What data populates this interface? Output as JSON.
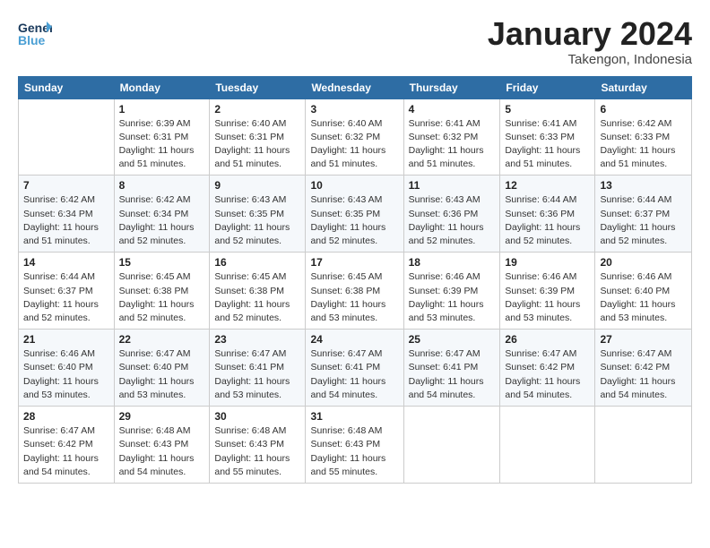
{
  "header": {
    "logo_general": "General",
    "logo_blue": "Blue",
    "month_title": "January 2024",
    "location": "Takengon, Indonesia"
  },
  "days_of_week": [
    "Sunday",
    "Monday",
    "Tuesday",
    "Wednesday",
    "Thursday",
    "Friday",
    "Saturday"
  ],
  "weeks": [
    [
      {
        "day": "",
        "sunrise": "",
        "sunset": "",
        "daylight": ""
      },
      {
        "day": "1",
        "sunrise": "Sunrise: 6:39 AM",
        "sunset": "Sunset: 6:31 PM",
        "daylight": "Daylight: 11 hours and 51 minutes."
      },
      {
        "day": "2",
        "sunrise": "Sunrise: 6:40 AM",
        "sunset": "Sunset: 6:31 PM",
        "daylight": "Daylight: 11 hours and 51 minutes."
      },
      {
        "day": "3",
        "sunrise": "Sunrise: 6:40 AM",
        "sunset": "Sunset: 6:32 PM",
        "daylight": "Daylight: 11 hours and 51 minutes."
      },
      {
        "day": "4",
        "sunrise": "Sunrise: 6:41 AM",
        "sunset": "Sunset: 6:32 PM",
        "daylight": "Daylight: 11 hours and 51 minutes."
      },
      {
        "day": "5",
        "sunrise": "Sunrise: 6:41 AM",
        "sunset": "Sunset: 6:33 PM",
        "daylight": "Daylight: 11 hours and 51 minutes."
      },
      {
        "day": "6",
        "sunrise": "Sunrise: 6:42 AM",
        "sunset": "Sunset: 6:33 PM",
        "daylight": "Daylight: 11 hours and 51 minutes."
      }
    ],
    [
      {
        "day": "7",
        "sunrise": "Sunrise: 6:42 AM",
        "sunset": "Sunset: 6:34 PM",
        "daylight": "Daylight: 11 hours and 51 minutes."
      },
      {
        "day": "8",
        "sunrise": "Sunrise: 6:42 AM",
        "sunset": "Sunset: 6:34 PM",
        "daylight": "Daylight: 11 hours and 52 minutes."
      },
      {
        "day": "9",
        "sunrise": "Sunrise: 6:43 AM",
        "sunset": "Sunset: 6:35 PM",
        "daylight": "Daylight: 11 hours and 52 minutes."
      },
      {
        "day": "10",
        "sunrise": "Sunrise: 6:43 AM",
        "sunset": "Sunset: 6:35 PM",
        "daylight": "Daylight: 11 hours and 52 minutes."
      },
      {
        "day": "11",
        "sunrise": "Sunrise: 6:43 AM",
        "sunset": "Sunset: 6:36 PM",
        "daylight": "Daylight: 11 hours and 52 minutes."
      },
      {
        "day": "12",
        "sunrise": "Sunrise: 6:44 AM",
        "sunset": "Sunset: 6:36 PM",
        "daylight": "Daylight: 11 hours and 52 minutes."
      },
      {
        "day": "13",
        "sunrise": "Sunrise: 6:44 AM",
        "sunset": "Sunset: 6:37 PM",
        "daylight": "Daylight: 11 hours and 52 minutes."
      }
    ],
    [
      {
        "day": "14",
        "sunrise": "Sunrise: 6:44 AM",
        "sunset": "Sunset: 6:37 PM",
        "daylight": "Daylight: 11 hours and 52 minutes."
      },
      {
        "day": "15",
        "sunrise": "Sunrise: 6:45 AM",
        "sunset": "Sunset: 6:38 PM",
        "daylight": "Daylight: 11 hours and 52 minutes."
      },
      {
        "day": "16",
        "sunrise": "Sunrise: 6:45 AM",
        "sunset": "Sunset: 6:38 PM",
        "daylight": "Daylight: 11 hours and 52 minutes."
      },
      {
        "day": "17",
        "sunrise": "Sunrise: 6:45 AM",
        "sunset": "Sunset: 6:38 PM",
        "daylight": "Daylight: 11 hours and 53 minutes."
      },
      {
        "day": "18",
        "sunrise": "Sunrise: 6:46 AM",
        "sunset": "Sunset: 6:39 PM",
        "daylight": "Daylight: 11 hours and 53 minutes."
      },
      {
        "day": "19",
        "sunrise": "Sunrise: 6:46 AM",
        "sunset": "Sunset: 6:39 PM",
        "daylight": "Daylight: 11 hours and 53 minutes."
      },
      {
        "day": "20",
        "sunrise": "Sunrise: 6:46 AM",
        "sunset": "Sunset: 6:40 PM",
        "daylight": "Daylight: 11 hours and 53 minutes."
      }
    ],
    [
      {
        "day": "21",
        "sunrise": "Sunrise: 6:46 AM",
        "sunset": "Sunset: 6:40 PM",
        "daylight": "Daylight: 11 hours and 53 minutes."
      },
      {
        "day": "22",
        "sunrise": "Sunrise: 6:47 AM",
        "sunset": "Sunset: 6:40 PM",
        "daylight": "Daylight: 11 hours and 53 minutes."
      },
      {
        "day": "23",
        "sunrise": "Sunrise: 6:47 AM",
        "sunset": "Sunset: 6:41 PM",
        "daylight": "Daylight: 11 hours and 53 minutes."
      },
      {
        "day": "24",
        "sunrise": "Sunrise: 6:47 AM",
        "sunset": "Sunset: 6:41 PM",
        "daylight": "Daylight: 11 hours and 54 minutes."
      },
      {
        "day": "25",
        "sunrise": "Sunrise: 6:47 AM",
        "sunset": "Sunset: 6:41 PM",
        "daylight": "Daylight: 11 hours and 54 minutes."
      },
      {
        "day": "26",
        "sunrise": "Sunrise: 6:47 AM",
        "sunset": "Sunset: 6:42 PM",
        "daylight": "Daylight: 11 hours and 54 minutes."
      },
      {
        "day": "27",
        "sunrise": "Sunrise: 6:47 AM",
        "sunset": "Sunset: 6:42 PM",
        "daylight": "Daylight: 11 hours and 54 minutes."
      }
    ],
    [
      {
        "day": "28",
        "sunrise": "Sunrise: 6:47 AM",
        "sunset": "Sunset: 6:42 PM",
        "daylight": "Daylight: 11 hours and 54 minutes."
      },
      {
        "day": "29",
        "sunrise": "Sunrise: 6:48 AM",
        "sunset": "Sunset: 6:43 PM",
        "daylight": "Daylight: 11 hours and 54 minutes."
      },
      {
        "day": "30",
        "sunrise": "Sunrise: 6:48 AM",
        "sunset": "Sunset: 6:43 PM",
        "daylight": "Daylight: 11 hours and 55 minutes."
      },
      {
        "day": "31",
        "sunrise": "Sunrise: 6:48 AM",
        "sunset": "Sunset: 6:43 PM",
        "daylight": "Daylight: 11 hours and 55 minutes."
      },
      {
        "day": "",
        "sunrise": "",
        "sunset": "",
        "daylight": ""
      },
      {
        "day": "",
        "sunrise": "",
        "sunset": "",
        "daylight": ""
      },
      {
        "day": "",
        "sunrise": "",
        "sunset": "",
        "daylight": ""
      }
    ]
  ]
}
